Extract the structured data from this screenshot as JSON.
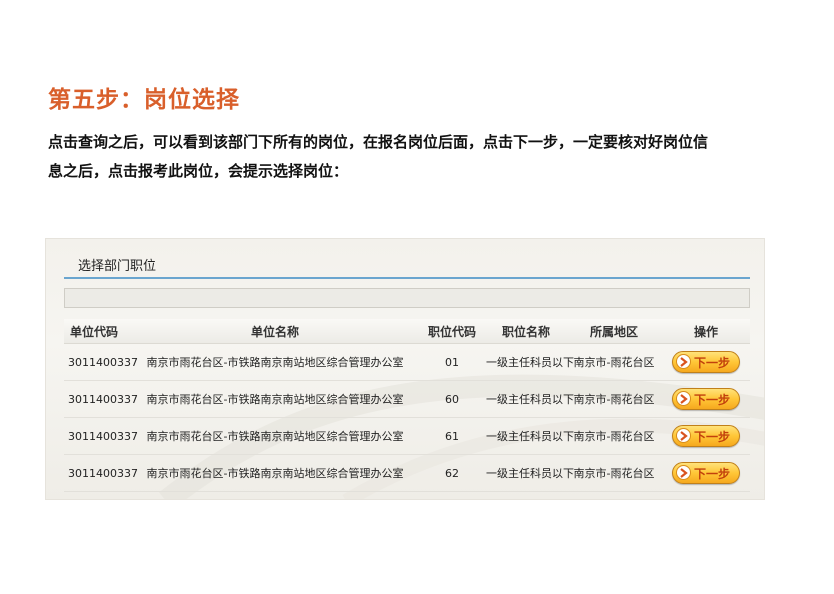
{
  "step_title": "第五步：岗位选择",
  "description": {
    "line1": "点击查询之后，可以看到该部门下所有的岗位，在报名岗位后面，点击下一步，一定要核对好岗位信",
    "line2": "息之后，点击报考此岗位，会提示选择岗位："
  },
  "panel": {
    "title": "选择部门职位",
    "columns": [
      "单位代码",
      "单位名称",
      "职位代码",
      "职位名称",
      "所属地区",
      "操作"
    ],
    "rows": [
      {
        "unit_code": "3011400337",
        "unit_name": "南京市雨花台区-市铁路南京南站地区综合管理办公室",
        "job_code": "01",
        "job_name": "一级主任科员以下",
        "region": "南京市-雨花台区",
        "action": "下一步"
      },
      {
        "unit_code": "3011400337",
        "unit_name": "南京市雨花台区-市铁路南京南站地区综合管理办公室",
        "job_code": "60",
        "job_name": "一级主任科员以下",
        "region": "南京市-雨花台区",
        "action": "下一步"
      },
      {
        "unit_code": "3011400337",
        "unit_name": "南京市雨花台区-市铁路南京南站地区综合管理办公室",
        "job_code": "61",
        "job_name": "一级主任科员以下",
        "region": "南京市-雨花台区",
        "action": "下一步"
      },
      {
        "unit_code": "3011400337",
        "unit_name": "南京市雨花台区-市铁路南京南站地区综合管理办公室",
        "job_code": "62",
        "job_name": "一级主任科员以下",
        "region": "南京市-雨花台区",
        "action": "下一步"
      }
    ]
  },
  "colors": {
    "title": "#d95f2b",
    "header_underline": "#6aa5cf",
    "button": "#ffc637",
    "button_text": "#c2410c"
  },
  "icons": {
    "next_button_icon": "chevron-right-icon"
  }
}
